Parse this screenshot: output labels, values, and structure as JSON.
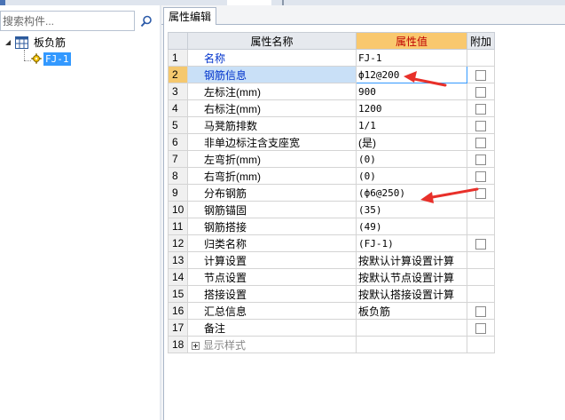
{
  "colors": {
    "selection": "#3399ff",
    "header_highlight": "#f9c86e",
    "header_highlight_text": "#c00000",
    "arrow": "#e8302a",
    "link_text": "#0033cc"
  },
  "left_panel": {
    "search": {
      "placeholder": "搜索构件...",
      "value": ""
    },
    "search_icon": "search-icon",
    "tree": {
      "root": {
        "label": "板负筋",
        "expanded": true,
        "icon": "grid-icon"
      },
      "child": {
        "label": "FJ-1",
        "selected": true,
        "icon": "gear-icon"
      }
    }
  },
  "right_panel": {
    "tab_label": "属性编辑",
    "columns": {
      "name": "属性名称",
      "value": "属性值",
      "extra": "附加"
    },
    "rows": [
      {
        "num": "1",
        "name": "名称",
        "value": "FJ-1",
        "checkbox": false,
        "blue": true,
        "selected": false
      },
      {
        "num": "2",
        "name": "钢筋信息",
        "value": "ф12@200",
        "checkbox": true,
        "blue": true,
        "selected": true
      },
      {
        "num": "3",
        "name": "左标注(mm)",
        "value": "900",
        "checkbox": true,
        "blue": false,
        "selected": false
      },
      {
        "num": "4",
        "name": "右标注(mm)",
        "value": "1200",
        "checkbox": true,
        "blue": false,
        "selected": false
      },
      {
        "num": "5",
        "name": "马凳筋排数",
        "value": "1/1",
        "checkbox": true,
        "blue": false,
        "selected": false
      },
      {
        "num": "6",
        "name": "非单边标注含支座宽",
        "value": "(是)",
        "checkbox": true,
        "blue": false,
        "selected": false
      },
      {
        "num": "7",
        "name": "左弯折(mm)",
        "value": "(0)",
        "checkbox": true,
        "blue": false,
        "selected": false
      },
      {
        "num": "8",
        "name": "右弯折(mm)",
        "value": "(0)",
        "checkbox": true,
        "blue": false,
        "selected": false
      },
      {
        "num": "9",
        "name": "分布钢筋",
        "value": "(ф6@250)",
        "checkbox": true,
        "blue": false,
        "selected": false
      },
      {
        "num": "10",
        "name": "钢筋锚固",
        "value": "(35)",
        "checkbox": false,
        "blue": false,
        "selected": false
      },
      {
        "num": "11",
        "name": "钢筋搭接",
        "value": "(49)",
        "checkbox": false,
        "blue": false,
        "selected": false
      },
      {
        "num": "12",
        "name": "归类名称",
        "value": "(FJ-1)",
        "checkbox": true,
        "blue": false,
        "selected": false
      },
      {
        "num": "13",
        "name": "计算设置",
        "value": "按默认计算设置计算",
        "checkbox": false,
        "blue": false,
        "selected": false
      },
      {
        "num": "14",
        "name": "节点设置",
        "value": "按默认节点设置计算",
        "checkbox": false,
        "blue": false,
        "selected": false
      },
      {
        "num": "15",
        "name": "搭接设置",
        "value": "按默认搭接设置计算",
        "checkbox": false,
        "blue": false,
        "selected": false
      },
      {
        "num": "16",
        "name": "汇总信息",
        "value": "板负筋",
        "checkbox": true,
        "blue": false,
        "selected": false
      },
      {
        "num": "17",
        "name": "备注",
        "value": "",
        "checkbox": true,
        "blue": false,
        "selected": false
      }
    ],
    "group_row": {
      "num": "18",
      "label": "显示样式",
      "expanded": false
    }
  }
}
